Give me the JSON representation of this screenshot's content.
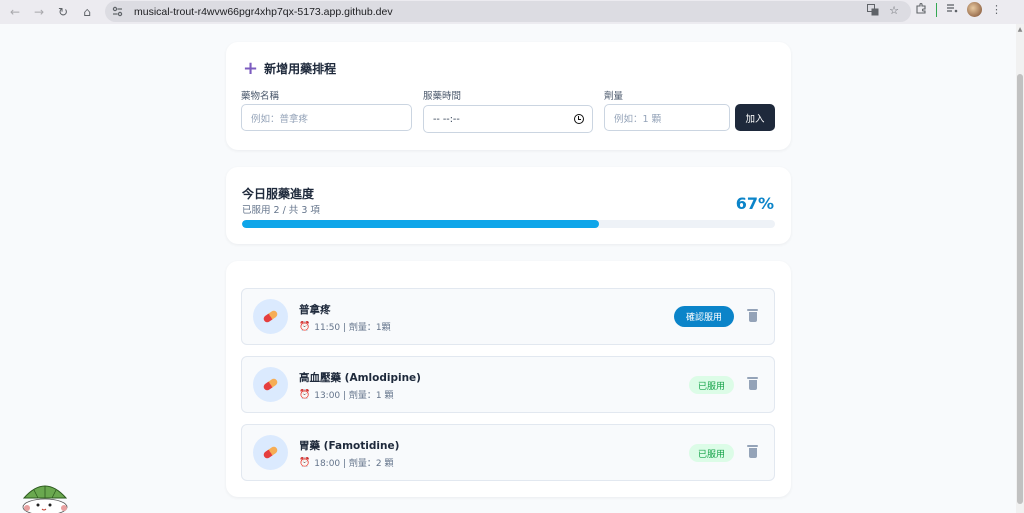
{
  "browser": {
    "url": "musical-trout-r4wvw66pgr4xhp7qx-5173.app.github.dev"
  },
  "add_form": {
    "title": "新增用藥排程",
    "name_label": "藥物名稱",
    "name_placeholder": "例如：普拿疼",
    "time_label": "服藥時間",
    "time_value": "-- --:--",
    "dose_label": "劑量",
    "dose_placeholder": "例如：1 顆",
    "add_label": "加入"
  },
  "progress": {
    "title": "今日服藥進度",
    "subtitle": "已服用 2 / 共 3 項",
    "percent_label": "67%",
    "fraction": 0.67,
    "color": "#0ea5e9"
  },
  "medications": [
    {
      "name": "普拿疼",
      "meta": "11:50 | 劑量：1顆",
      "status": "pending",
      "action_label": "確認服用"
    },
    {
      "name": "高血壓藥 (Amlodipine)",
      "meta": "13:00 | 劑量：1 顆",
      "status": "taken",
      "action_label": "已服用"
    },
    {
      "name": "胃藥 (Famotidine)",
      "meta": "18:00 | 劑量：2 顆",
      "status": "taken",
      "action_label": "已服用"
    }
  ],
  "colors": {
    "primary": "#0b84c9",
    "dark_button": "#1e293b",
    "taken_bg": "#dcfce7",
    "taken_text": "#16a34a"
  }
}
